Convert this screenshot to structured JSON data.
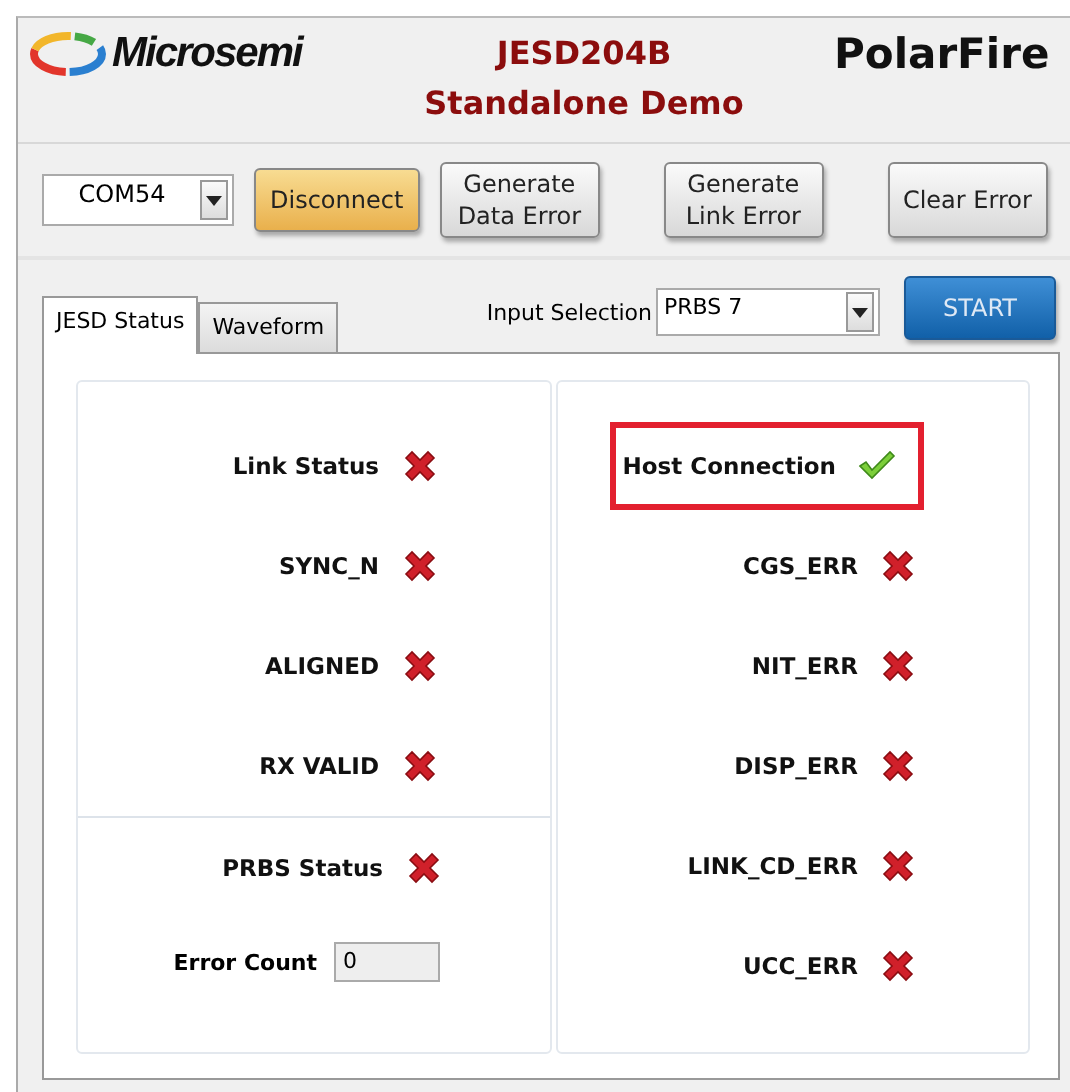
{
  "header": {
    "logo_text": "Microsemi",
    "title_lines": [
      "JESD204B",
      "Standalone Demo"
    ],
    "product": "PolarFire"
  },
  "toolbar": {
    "port": {
      "value": "COM54"
    },
    "buttons": [
      {
        "label": "Disconnect",
        "kind": "active"
      },
      {
        "label": "Generate\nData Error",
        "kind": "normal"
      },
      {
        "label": "Generate\nLink Error",
        "kind": "normal"
      },
      {
        "label": "Clear Error",
        "kind": "normal"
      }
    ]
  },
  "tabs": [
    {
      "label": "JESD Status",
      "selected": true
    },
    {
      "label": "Waveform",
      "selected": false
    }
  ],
  "input_selection": {
    "label": "Input Selection",
    "value": "PRBS 7"
  },
  "start_button": {
    "label": "START"
  },
  "left_panel": {
    "indicators": [
      {
        "label": "Link Status",
        "ok": false
      },
      {
        "label": "SYNC_N",
        "ok": false
      },
      {
        "label": "ALIGNED",
        "ok": false
      },
      {
        "label": "RX VALID",
        "ok": false
      }
    ],
    "prbs": {
      "label": "PRBS Status",
      "ok": false
    },
    "error_count": {
      "label": "Error Count",
      "value": "0"
    }
  },
  "right_panel": {
    "indicators": [
      {
        "label": "Host Connection",
        "ok": true,
        "highlighted": true
      },
      {
        "label": "CGS_ERR",
        "ok": false,
        "highlighted": false
      },
      {
        "label": "NIT_ERR",
        "ok": false,
        "highlighted": false
      },
      {
        "label": "DISP_ERR",
        "ok": false,
        "highlighted": false
      },
      {
        "label": "LINK_CD_ERR",
        "ok": false,
        "highlighted": false
      },
      {
        "label": "UCC_ERR",
        "ok": false,
        "highlighted": false
      }
    ]
  }
}
